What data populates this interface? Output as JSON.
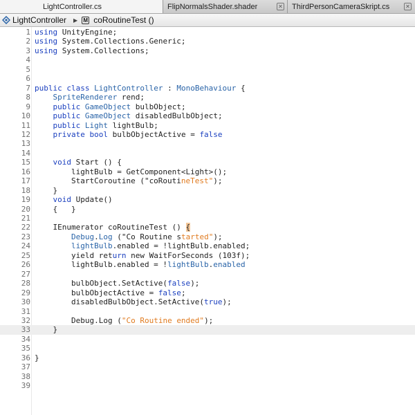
{
  "tabs": [
    {
      "label": "LightController.cs",
      "active": true
    },
    {
      "label": "FlipNormalsShader.shader",
      "active": false
    },
    {
      "label": "ThirdPersonCameraSkript.cs",
      "active": false
    }
  ],
  "breadcrumb": {
    "class_name": "LightController",
    "method_name": "coRoutineTest ()"
  },
  "editor": {
    "current_line": 33,
    "lines": [
      {
        "n": "1",
        "tokens": [
          [
            "kw",
            "using"
          ],
          [
            "",
            " UnityEngine;"
          ]
        ]
      },
      {
        "n": "2",
        "tokens": [
          [
            "kw",
            "using"
          ],
          [
            "",
            " System.Collections.Generic;"
          ]
        ]
      },
      {
        "n": "3",
        "tokens": [
          [
            "kw",
            "using"
          ],
          [
            "",
            " System.Collections;"
          ]
        ]
      },
      {
        "n": "4",
        "tokens": []
      },
      {
        "n": "5",
        "tokens": []
      },
      {
        "n": "6",
        "tokens": []
      },
      {
        "n": "7",
        "tokens": [
          [
            "kw",
            "public class"
          ],
          [
            "",
            " "
          ],
          [
            "ty",
            "LightController"
          ],
          [
            "",
            " : "
          ],
          [
            "ty",
            "MonoBehaviour"
          ],
          [
            "",
            " {"
          ]
        ]
      },
      {
        "n": "8",
        "tokens": [
          [
            "",
            "    "
          ],
          [
            "ty",
            "SpriteRenderer"
          ],
          [
            "",
            " rend;"
          ]
        ]
      },
      {
        "n": "9",
        "tokens": [
          [
            "",
            "    "
          ],
          [
            "kw",
            "public"
          ],
          [
            "",
            " "
          ],
          [
            "ty",
            "GameObject"
          ],
          [
            "",
            " bulbObject;"
          ]
        ]
      },
      {
        "n": "10",
        "tokens": [
          [
            "",
            "    "
          ],
          [
            "kw",
            "public"
          ],
          [
            "",
            " "
          ],
          [
            "ty",
            "GameObject"
          ],
          [
            "",
            " disabledBulbObject;"
          ]
        ]
      },
      {
        "n": "11",
        "tokens": [
          [
            "",
            "    "
          ],
          [
            "kw",
            "public"
          ],
          [
            "",
            " "
          ],
          [
            "ty",
            "Light"
          ],
          [
            "",
            " lightBulb;"
          ]
        ]
      },
      {
        "n": "12",
        "tokens": [
          [
            "",
            "    "
          ],
          [
            "kw",
            "private bool"
          ],
          [
            "",
            " bulbObjectActive = "
          ],
          [
            "lit",
            "false"
          ],
          [
            ";"
          ]
        ]
      },
      {
        "n": "13",
        "tokens": []
      },
      {
        "n": "14",
        "tokens": []
      },
      {
        "n": "15",
        "tokens": [
          [
            "",
            "    "
          ],
          [
            "kw",
            "void"
          ],
          [
            "",
            " Start () {"
          ]
        ]
      },
      {
        "n": "16",
        "tokens": [
          [
            "",
            "        lightBulb = GetComponent<Light>();"
          ]
        ]
      },
      {
        "n": "17",
        "tokens": [
          [
            "",
            "        StartCoroutine (\"coRouti"
          ],
          [
            "str",
            "neTest\""
          ],
          [
            "",
            ");"
          ]
        ]
      },
      {
        "n": "18",
        "tokens": [
          [
            "",
            "    }"
          ]
        ]
      },
      {
        "n": "19",
        "tokens": [
          [
            "",
            "    "
          ],
          [
            "kw",
            "void"
          ],
          [
            "",
            " Update()"
          ]
        ]
      },
      {
        "n": "20",
        "tokens": [
          [
            "",
            "    {   }"
          ]
        ]
      },
      {
        "n": "21",
        "tokens": []
      },
      {
        "n": "22",
        "tokens": [
          [
            "",
            "    IEnumerator coRoutineTest () "
          ],
          [
            "brace",
            "{"
          ]
        ]
      },
      {
        "n": "23",
        "tokens": [
          [
            "",
            "        "
          ],
          [
            "ty",
            "Debug"
          ],
          [
            "",
            "."
          ],
          [
            "ty",
            "Log"
          ],
          [
            "",
            " (\"Co Routine s"
          ],
          [
            "str",
            "tarted\""
          ],
          [
            "",
            ");"
          ]
        ]
      },
      {
        "n": "24",
        "tokens": [
          [
            "",
            "        "
          ],
          [
            "ty",
            "lightBulb"
          ],
          [
            "",
            ".enabled = !lightBulb.enabled;"
          ]
        ]
      },
      {
        "n": "25",
        "tokens": [
          [
            "",
            "        yield ret"
          ],
          [
            "kw",
            "urn"
          ],
          [
            "",
            " new WaitForSeconds (103f);"
          ]
        ]
      },
      {
        "n": "26",
        "tokens": [
          [
            "",
            "        lightBulb.enabled = !"
          ],
          [
            "ty",
            "lightBulb"
          ],
          [
            "",
            "."
          ],
          [
            "ty",
            "enabled"
          ]
        ]
      },
      {
        "n": "27",
        "tokens": []
      },
      {
        "n": "28",
        "tokens": [
          [
            "",
            "        bulbObject.SetActive("
          ],
          [
            "lit",
            "false"
          ],
          [
            "",
            ");"
          ]
        ]
      },
      {
        "n": "29",
        "tokens": [
          [
            "",
            "        bulbObjectActive = "
          ],
          [
            "lit",
            "false"
          ],
          [
            "",
            ";"
          ]
        ]
      },
      {
        "n": "30",
        "tokens": [
          [
            "",
            "        disabledBulbObject.SetActive("
          ],
          [
            "lit",
            "true"
          ],
          [
            "",
            ");"
          ]
        ]
      },
      {
        "n": "31",
        "tokens": []
      },
      {
        "n": "32",
        "tokens": [
          [
            "",
            "        Debug.Log ("
          ],
          [
            "str",
            "\"Co Routine ended\""
          ],
          [
            "",
            ");"
          ]
        ]
      },
      {
        "n": "33",
        "tokens": [
          [
            "",
            "    }"
          ]
        ]
      },
      {
        "n": "34",
        "tokens": []
      },
      {
        "n": "35",
        "tokens": []
      },
      {
        "n": "36",
        "tokens": [
          [
            "",
            "}"
          ]
        ]
      },
      {
        "n": "37",
        "tokens": []
      },
      {
        "n": "38",
        "tokens": []
      },
      {
        "n": "39",
        "tokens": []
      }
    ]
  }
}
